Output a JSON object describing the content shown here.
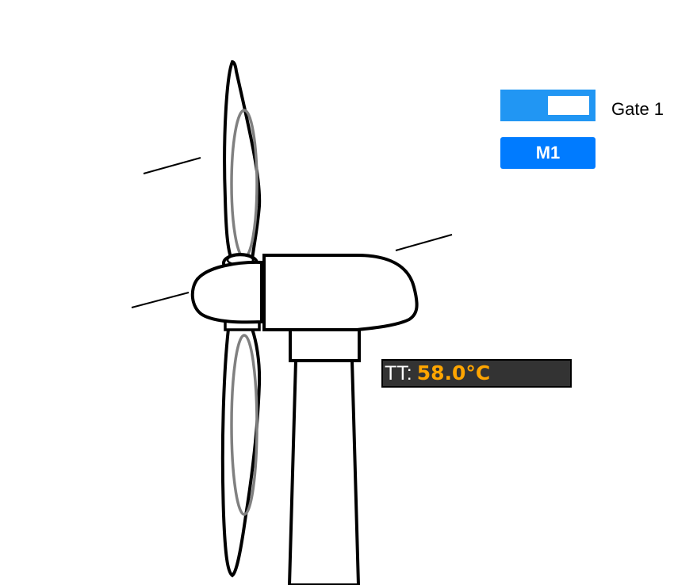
{
  "gate_toggle": {
    "label": "Gate 1",
    "state": "on",
    "color": "#2196f3"
  },
  "mode_button": {
    "label": "M1",
    "color": "#007bff"
  },
  "temperature_readout": {
    "label": "TT:",
    "value": "58.0°C",
    "value_color": "#ffa500",
    "background": "#333333"
  }
}
